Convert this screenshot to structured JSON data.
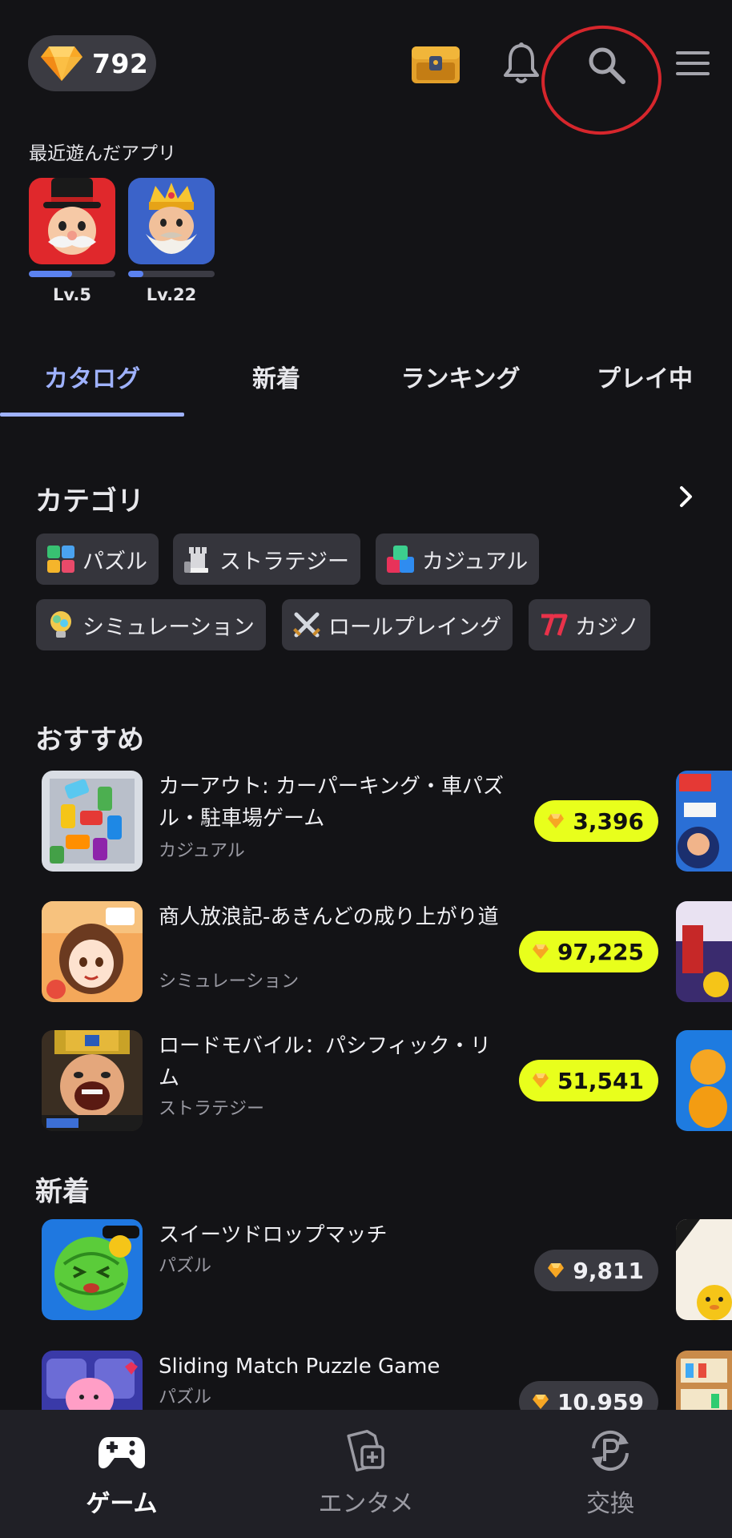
{
  "header": {
    "gem_count": "792",
    "icons": [
      "diamond-icon",
      "treasure-chest-icon",
      "bell-icon",
      "search-icon",
      "menu-icon"
    ]
  },
  "recent": {
    "title": "最近遊んだアプリ",
    "apps": [
      {
        "level": "Lv.5",
        "progress": 0.5
      },
      {
        "level": "Lv.22",
        "progress": 0.18
      }
    ]
  },
  "tabs": [
    "カタログ",
    "新着",
    "ランキング",
    "プレイ中"
  ],
  "categories": {
    "title": "カテゴリ",
    "items": [
      "パズル",
      "ストラテジー",
      "カジュアル",
      "シミュレーション",
      "ロールプレイング",
      "カジノ"
    ]
  },
  "recommended": {
    "title": "おすすめ",
    "apps": [
      {
        "name": "カーアウト: カーパーキング・車パズル・駐車場ゲーム",
        "genre": "カジュアル",
        "price": "3,396"
      },
      {
        "name": "商人放浪記-あきんどの成り上がり道",
        "genre": "シミュレーション",
        "price": "97,225"
      },
      {
        "name": "ロードモバイル：パシフィック・リム",
        "genre": "ストラテジー",
        "price": "51,541"
      }
    ]
  },
  "new_arrivals": {
    "title": "新着",
    "apps": [
      {
        "name": "スイーツドロップマッチ",
        "genre": "パズル",
        "price": "9,811"
      },
      {
        "name": "Sliding Match Puzzle Game",
        "genre": "パズル",
        "price": "10,959"
      }
    ]
  },
  "bottom_nav": [
    "ゲーム",
    "エンタメ",
    "交換"
  ],
  "colors": {
    "background": "#131316",
    "accent": "#9fb2ff",
    "price_highlight": "#e8ff1c",
    "annotation": "#d6262c"
  }
}
